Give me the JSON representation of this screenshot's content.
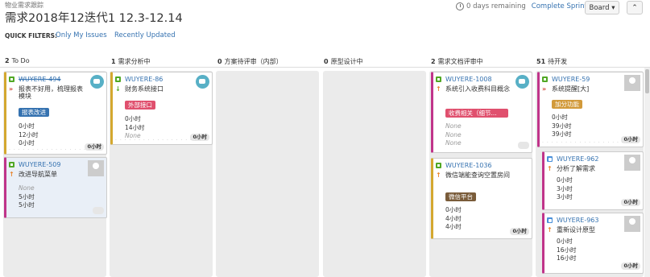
{
  "breadcrumb": "物业需求跟踪",
  "title": "需求2018年12迭代1 12.3-12.14",
  "sprint": {
    "remaining": "0 days remaining",
    "complete": "Complete Sprint"
  },
  "board_button": "Board ▾",
  "collapse_button": "⌃",
  "quick_filters": {
    "label": "QUICK FILTERS:",
    "items": [
      "Only My Issues",
      "Recently Updated"
    ]
  },
  "columns": [
    {
      "count": "2",
      "name": "To Do"
    },
    {
      "count": "1",
      "name": "需求分析中"
    },
    {
      "count": "0",
      "name": "方案待评审（内部）"
    },
    {
      "count": "0",
      "name": "原型设计中"
    },
    {
      "count": "2",
      "name": "需求文档评审中"
    },
    {
      "count": "51",
      "name": "待开发"
    }
  ],
  "cards": [
    {
      "key": "WUYERE-494",
      "summary": "报表不好用，梳理报表模块",
      "label": "报表改进",
      "fields": [
        "0小时",
        "12小时",
        "0小时"
      ],
      "badge": "0小时",
      "priority": "»",
      "label_color": "#3572b0"
    },
    {
      "key": "WUYERE-509",
      "summary": "改进导航菜单",
      "fields": [
        "None",
        "5小时",
        "5小时"
      ],
      "priority": "↑"
    },
    {
      "key": "WUYERE-86",
      "summary": "财务系统接口",
      "label": "外部接口",
      "fields": [
        "0小时",
        "14小时",
        "None"
      ],
      "badge": "0小时",
      "priority": "↓",
      "label_color": "#e0506e"
    },
    {
      "key": "WUYERE-1008",
      "summary": "系统引入收费科目概念",
      "label": "收费相关（细节...",
      "fields": [
        "None",
        "None",
        "None"
      ],
      "priority": "↑",
      "label_color": "#e0506e"
    },
    {
      "key": "WUYERE-1036",
      "summary": "微信端能查询空置房间",
      "label": "微信平台",
      "fields": [
        "0小时",
        "4小时",
        "4小时"
      ],
      "badge": "0小时",
      "priority": "↑",
      "label_color": "#7a5c3a"
    },
    {
      "key": "WUYERE-59",
      "summary": "系统提醒[大]",
      "label": "加分功能",
      "fields": [
        "0小时",
        "39小时",
        "39小时"
      ],
      "badge": "0小时",
      "priority": "»",
      "label_color": "#d29a3a"
    },
    {
      "key": "WUYERE-962",
      "summary": "分析了解需求",
      "fields": [
        "0小时",
        "3小时",
        "3小时"
      ],
      "badge": "0小时",
      "priority": "↑"
    },
    {
      "key": "WUYERE-963",
      "summary": "重新设计原型",
      "fields": [
        "0小时",
        "16小时",
        "16小时"
      ],
      "badge": "0小时",
      "priority": "↑"
    }
  ]
}
